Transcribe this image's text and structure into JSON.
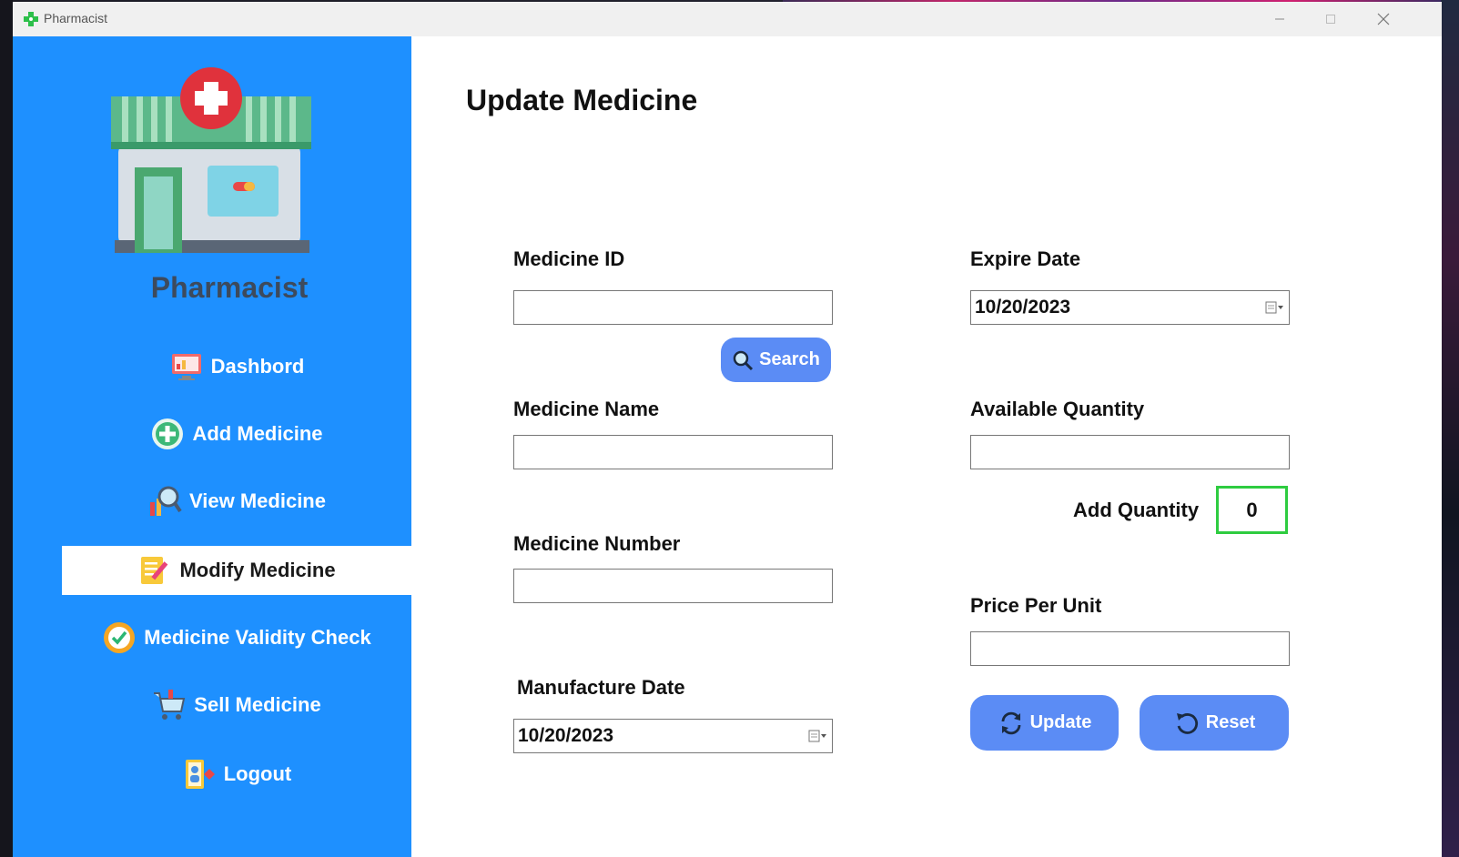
{
  "window": {
    "title": "Pharmacist"
  },
  "sidebar": {
    "brand": "Pharmacist",
    "items": [
      {
        "label": "Dashbord",
        "icon": "dashboard-icon"
      },
      {
        "label": "Add Medicine",
        "icon": "add-icon"
      },
      {
        "label": "View Medicine",
        "icon": "magnifier-icon"
      },
      {
        "label": "Modify Medicine",
        "icon": "edit-note-icon",
        "active": true
      },
      {
        "label": "Medicine Validity Check",
        "icon": "check-badge-icon"
      },
      {
        "label": "Sell Medicine",
        "icon": "cart-icon"
      },
      {
        "label": "Logout",
        "icon": "logout-icon"
      }
    ]
  },
  "main": {
    "title": "Update Medicine",
    "medicine_id": {
      "label": "Medicine ID",
      "value": ""
    },
    "search_button": "Search",
    "medicine_name": {
      "label": "Medicine Name",
      "value": ""
    },
    "medicine_number": {
      "label": "Medicine Number",
      "value": ""
    },
    "manufacture_date": {
      "label": "Manufacture Date",
      "value": "10/20/2023"
    },
    "expire_date": {
      "label": "Expire Date",
      "value": "10/20/2023"
    },
    "available_quantity": {
      "label": "Available Quantity",
      "value": ""
    },
    "add_quantity": {
      "label": "Add Quantity",
      "value": "0"
    },
    "price_per_unit": {
      "label": "Price Per Unit",
      "value": ""
    },
    "update_button": "Update",
    "reset_button": "Reset"
  },
  "colors": {
    "sidebar": "#1e90ff",
    "button": "#5b8cf5",
    "qty_border": "#2ecc40"
  }
}
